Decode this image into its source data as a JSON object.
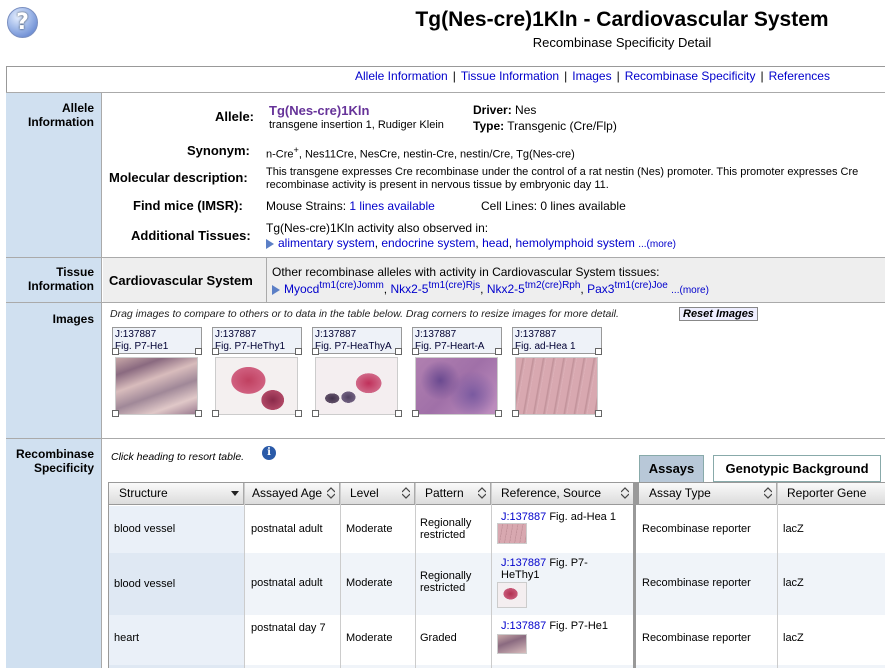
{
  "header": {
    "help_icon": "?",
    "title": "Tg(Nes-cre)1Kln - Cardiovascular System",
    "subtitle": "Recombinase Specificity Detail"
  },
  "nav": {
    "links": [
      "Allele Information",
      "Tissue Information",
      "Images",
      "Recombinase Specificity",
      "References"
    ],
    "separator": "|"
  },
  "allele_section": {
    "row_label": "Allele Information",
    "allele_label": "Allele:",
    "allele_symbol": "Tg(Nes-cre)1Kln",
    "allele_sub": "transgene insertion 1, Rudiger Klein",
    "driver_label": "Driver:",
    "driver_value": "Nes",
    "type_label": "Type:",
    "type_value": "Transgenic (Cre/Flp)",
    "synonym_label": "Synonym:",
    "synonym_value_pre": "n-Cre",
    "synonym_value_sup": "+",
    "synonym_value_post": ", Nes11Cre, NesCre, nestin-Cre, nestin/Cre, Tg(Nes-cre)",
    "molecular_label": "Molecular description:",
    "molecular_line1": "This transgene expresses Cre recombinase under the control of a rat nestin (Nes) promoter. This promoter expresses Cre",
    "molecular_line2": "recombinase activity is present in nervous tissue by embryonic day 11.",
    "imsr_label": "Find mice (IMSR):",
    "mouse_strains_label": "Mouse Strains:",
    "mouse_strains_link": "1 lines available",
    "cell_lines_text": "Cell Lines: 0 lines available",
    "additional_label": "Additional Tissues:",
    "additional_intro": "Tg(Nes-cre)1Kln activity also observed in:",
    "additional_tissues": [
      "alimentary system",
      "endocrine system",
      "head",
      "hemolymphoid system"
    ],
    "more": "...(more)"
  },
  "tissue_section": {
    "row_label": "Tissue Information",
    "tissue_name": "Cardiovascular System",
    "other_intro": "Other recombinase alleles with activity in Cardiovascular System tissues:",
    "alleles": [
      {
        "base": "Myocd",
        "sup": "tm1(cre)Jomm"
      },
      {
        "base": "Nkx2-5",
        "sup": "tm1(cre)Rjs"
      },
      {
        "base": "Nkx2-5",
        "sup": "tm2(cre)Rph"
      },
      {
        "base": "Pax3",
        "sup": "tm1(cre)Joe"
      }
    ],
    "more": "...(more)"
  },
  "images_section": {
    "row_label": "Images",
    "instructions": "Drag images to compare to others or to data in the table below. Drag corners to resize images for more detail.",
    "reset_button": "Reset Images",
    "thumbs": [
      {
        "jnum": "J:137887",
        "fig": "Fig. P7-He1"
      },
      {
        "jnum": "J:137887",
        "fig": "Fig. P7-HeThy1"
      },
      {
        "jnum": "J:137887",
        "fig": "Fig. P7-HeaThyA"
      },
      {
        "jnum": "J:137887",
        "fig": "Fig. P7-Heart-A"
      },
      {
        "jnum": "J:137887",
        "fig": "Fig. ad-Hea 1"
      }
    ]
  },
  "specificity_section": {
    "row_label": "Recombinase Specificity",
    "hint": "Click heading to resort table.",
    "info_icon": "i",
    "tabs": [
      "Assays",
      "Genotypic Background"
    ],
    "columns": [
      "Structure",
      "Assayed Age",
      "Level",
      "Pattern",
      "Reference, Source",
      "Assay Type",
      "Reporter Gene"
    ],
    "rows": [
      {
        "structure": "blood vessel",
        "age": "postnatal adult",
        "level": "Moderate",
        "pattern": "Regionally restricted",
        "ref_j": "J:137887",
        "ref_fig": "Fig. ad-Hea 1",
        "assay": "Recombinase reporter",
        "reporter": "lacZ"
      },
      {
        "structure": "blood vessel",
        "age": "postnatal adult",
        "level": "Moderate",
        "pattern": "Regionally restricted",
        "ref_j": "J:137887",
        "ref_fig": "Fig. P7-HeThy1",
        "assay": "Recombinase reporter",
        "reporter": "lacZ"
      },
      {
        "structure": "heart",
        "age": "postnatal day 7",
        "level": "Moderate",
        "pattern": "Graded",
        "ref_j": "J:137887",
        "ref_fig": "Fig. P7-He1",
        "assay": "Recombinase reporter",
        "reporter": "lacZ"
      }
    ]
  },
  "colors": {
    "side_bg": "#d0e0f0",
    "link": "#0000cc",
    "allele_link": "#663399",
    "active_tab": "#b8c8d8"
  }
}
